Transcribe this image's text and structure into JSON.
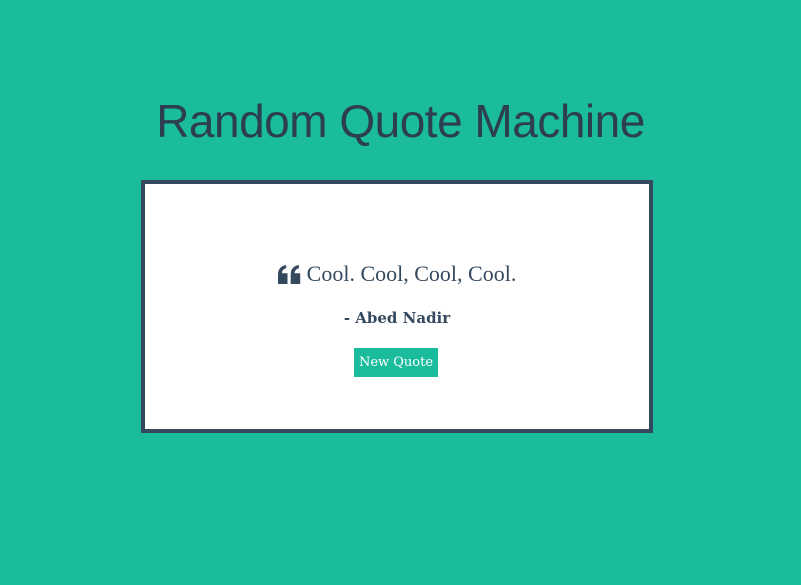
{
  "colors": {
    "background": "#1abc9c",
    "text": "#2c3e50",
    "box_border": "#34495e",
    "box_background": "#ffffff",
    "button_background": "#1abc9c",
    "button_text": "#ffffff"
  },
  "header": {
    "title": "Random Quote Machine"
  },
  "quote": {
    "icon": "quote-left-icon",
    "text": "Cool. Cool, Cool, Cool.",
    "author": "- Abed Nadir"
  },
  "actions": {
    "new_quote_label": "New Quote"
  }
}
